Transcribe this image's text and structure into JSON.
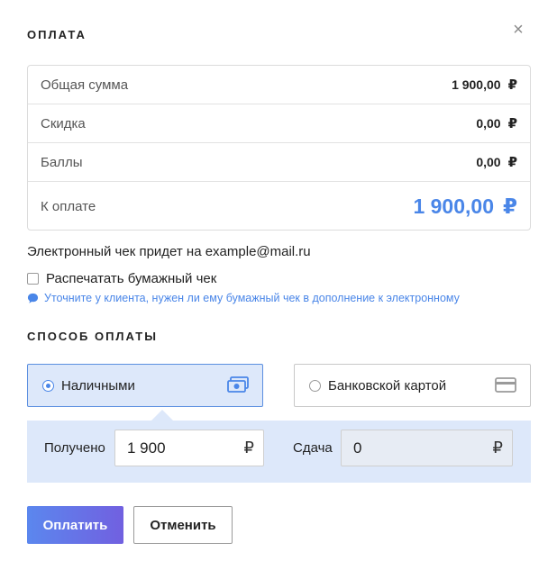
{
  "dialog": {
    "title": "ОПЛАТА",
    "close_icon": "close-icon"
  },
  "summary": {
    "rows": [
      {
        "label": "Общая сумма",
        "value": "1 900,00",
        "currency": "₽"
      },
      {
        "label": "Скидка",
        "value": "0,00",
        "currency": "₽"
      },
      {
        "label": "Баллы",
        "value": "0,00",
        "currency": "₽"
      },
      {
        "label": "К оплате",
        "value": "1 900,00",
        "currency": "₽"
      }
    ]
  },
  "receipt": {
    "electronic_text": "Электронный чек придет на example@mail.ru",
    "paper_label": "Распечатать бумажный чек",
    "paper_checked": false,
    "hint_icon": "speech-bubble-icon",
    "hint_text": "Уточните у клиента, нужен ли ему бумажный чек в дополнение к электронному"
  },
  "payment_method": {
    "title": "СПОСОБ ОПЛАТЫ",
    "options": [
      {
        "label": "Наличными",
        "icon": "cash-icon",
        "selected": true
      },
      {
        "label": "Банковской картой",
        "icon": "credit-card-icon",
        "selected": false
      }
    ]
  },
  "cash": {
    "received_label": "Получено",
    "received_value": "1 900",
    "change_label": "Сдача",
    "change_value": "0",
    "currency": "₽"
  },
  "actions": {
    "pay_label": "Оплатить",
    "cancel_label": "Отменить"
  },
  "colors": {
    "accent": "#4a86e8",
    "selected_bg": "#dde8fa",
    "pay_gradient_start": "#5b87ee",
    "pay_gradient_end": "#7160e0"
  }
}
